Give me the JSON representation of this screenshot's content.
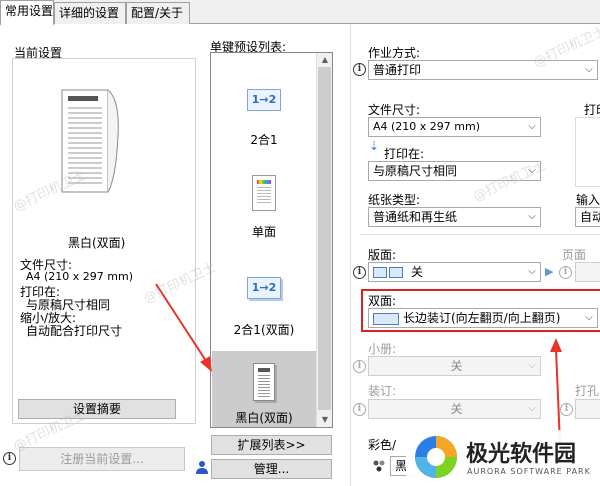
{
  "tabs": [
    "常用设置",
    "详细的设置",
    "配置/关于"
  ],
  "left": {
    "current_settings_title": "当前设置",
    "preview_caption": "黑白(双面)",
    "file_size_label": "文件尺寸:",
    "file_size_value": "A4 (210 x 297 mm)",
    "print_on_label": "打印在:",
    "print_on_value": "与原稿尺寸相同",
    "scale_label": "缩小/放大:",
    "scale_value": "自动配合打印尺寸",
    "summary_button": "设置摘要",
    "register_button": "注册当前设置..."
  },
  "presets": {
    "title": "单键预设列表:",
    "items": [
      {
        "label": "2合1",
        "icon": "two-in-one-icon",
        "glyph": "1→2"
      },
      {
        "label": "单面",
        "icon": "single-sided-icon"
      },
      {
        "label": "2合1(双面)",
        "icon": "two-in-one-duplex-icon",
        "glyph": "1→2"
      },
      {
        "label": "黑白(双面)",
        "icon": "bw-duplex-icon"
      }
    ],
    "expand_button": "扩展列表>>",
    "manage_button": "管理..."
  },
  "right": {
    "job_mode_label": "作业方式:",
    "job_mode_value": "普通打印",
    "file_size_label": "文件尺寸:",
    "file_size_value": "A4 (210 x 297 mm)",
    "print_on_label": "打印在:",
    "print_on_value": "与原稿尺寸相同",
    "paper_type_label": "纸张类型:",
    "paper_type_value": "普通纸和再生纸",
    "input_label": "输入",
    "input_value": "自动",
    "layout_label": "版面:",
    "layout_value": "关",
    "page_border_label": "页面",
    "duplex_label": "双面:",
    "duplex_value": "长边装订(向左翻页/向上翻页)",
    "booklet_label": "小册:",
    "booklet_value": "关",
    "binding_label": "装订:",
    "binding_value": "关",
    "punch_label": "打孔",
    "color_label": "彩色/",
    "color_value": "黑",
    "print_label": "打印"
  },
  "brand": {
    "name": "极光软件园",
    "sub": "AURORA SOFTWARE PARK"
  },
  "watermark": "@打印机卫士",
  "colors": {
    "highlight_red": "#e02020",
    "arrow_red": "#e8322a"
  }
}
